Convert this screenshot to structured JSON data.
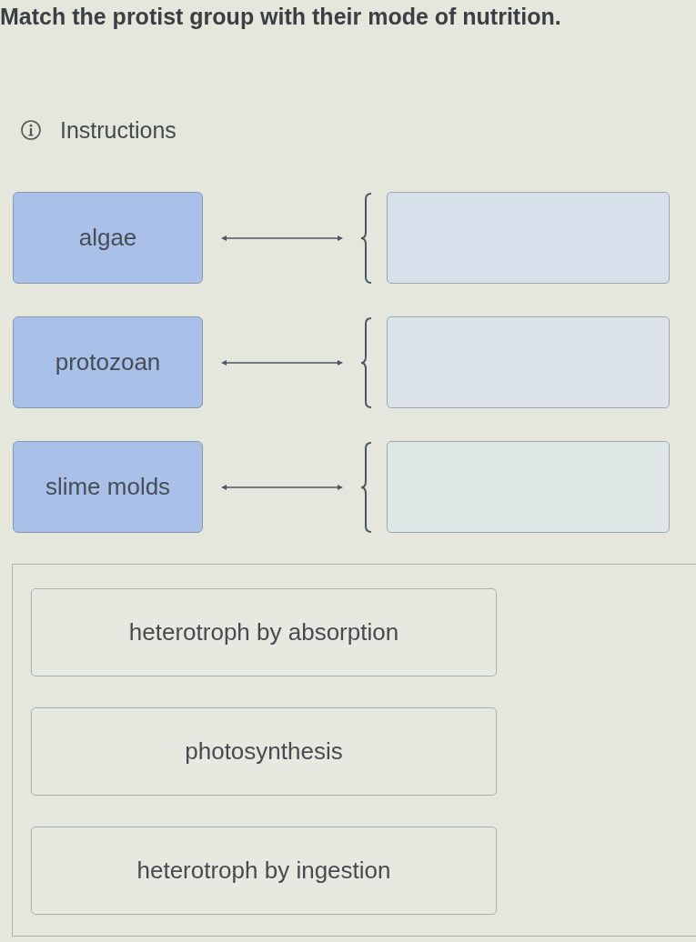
{
  "question": {
    "prompt": "Match the protist group with their mode of nutrition."
  },
  "instructions": {
    "label": "Instructions"
  },
  "pairs": [
    {
      "term": "algae"
    },
    {
      "term": "protozoan"
    },
    {
      "term": "slime molds"
    }
  ],
  "answer_bank": [
    {
      "label": "heterotroph by absorption"
    },
    {
      "label": "photosynthesis"
    },
    {
      "label": "heterotroph by ingestion"
    }
  ]
}
